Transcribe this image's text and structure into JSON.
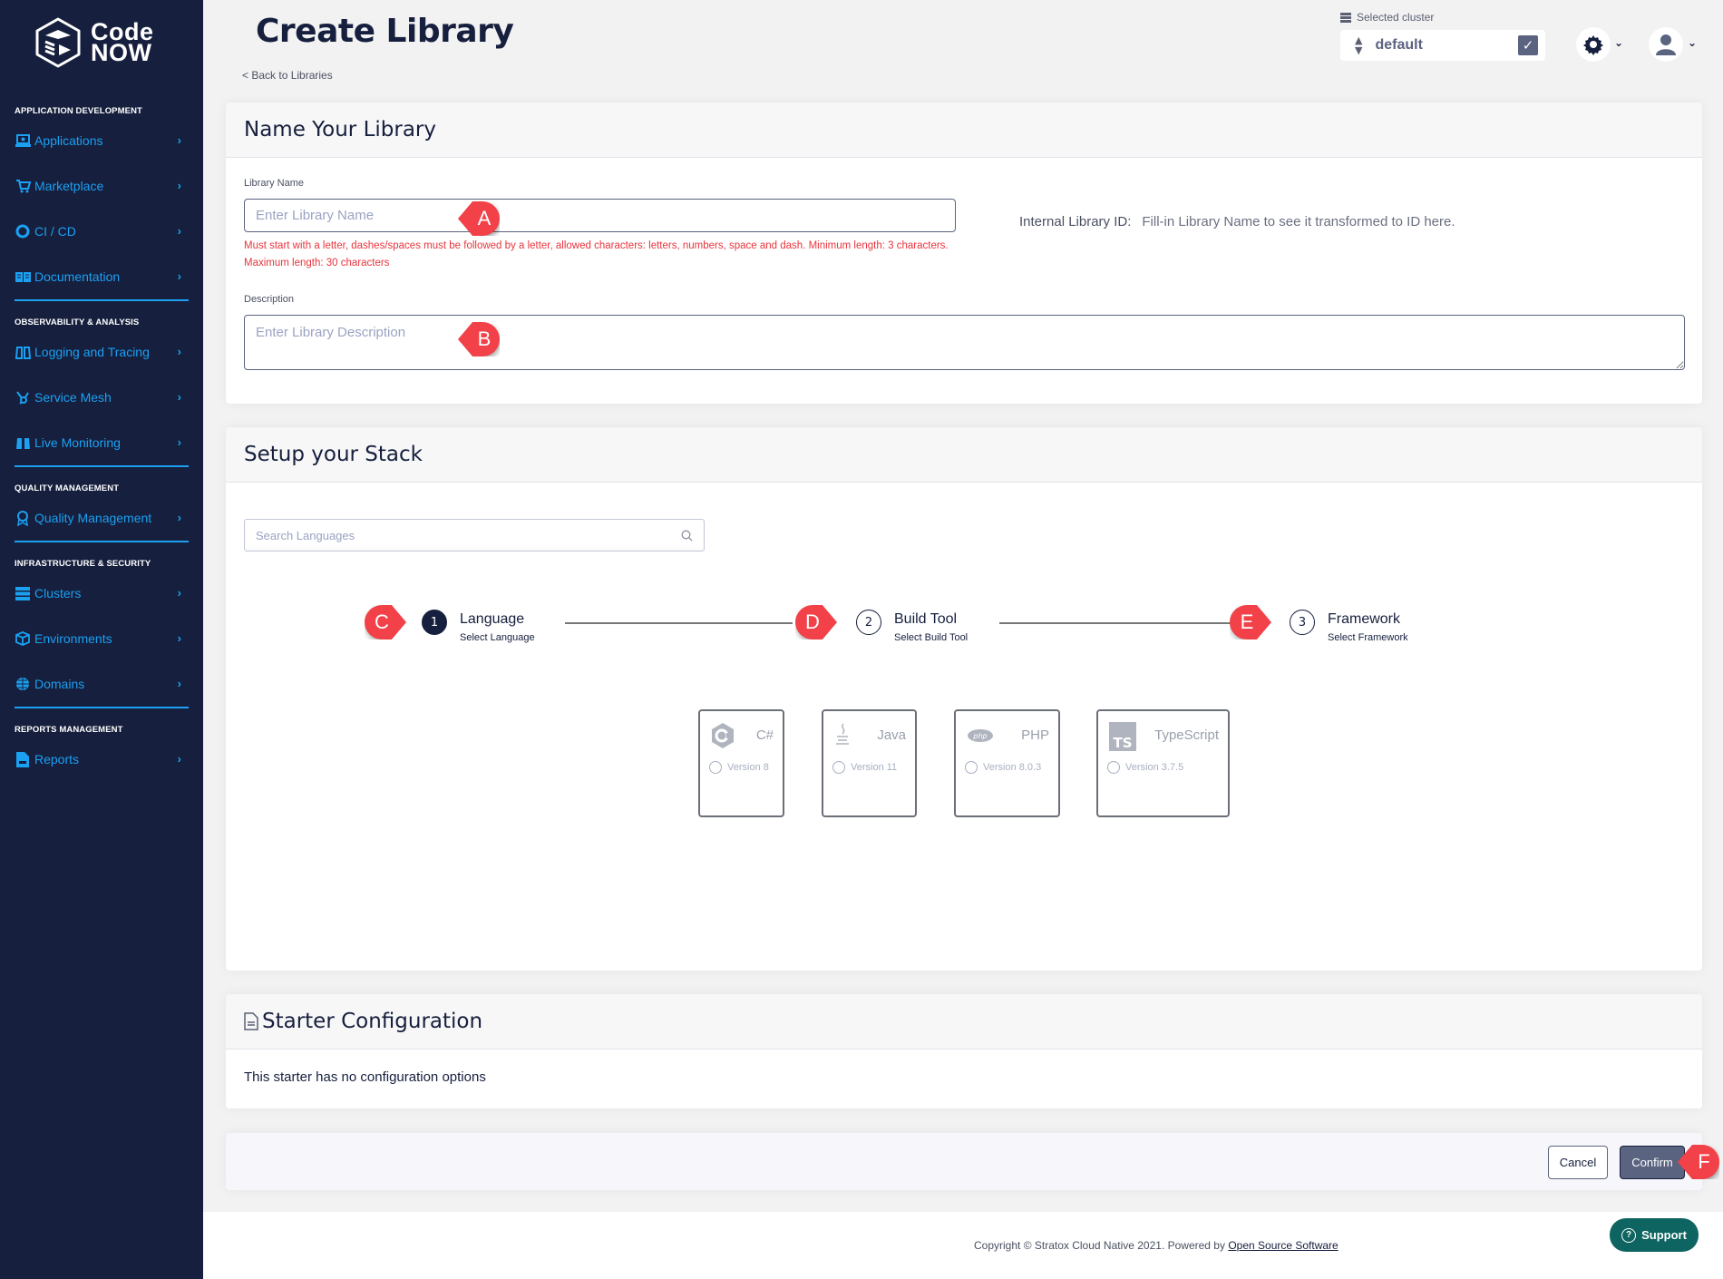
{
  "brand": {
    "line1": "Code",
    "line2": "NOW"
  },
  "sidebar": {
    "sections": [
      {
        "title": "APPLICATION DEVELOPMENT",
        "items": [
          {
            "label": "Applications",
            "icon": "laptop-icon"
          },
          {
            "label": "Marketplace",
            "icon": "cart-icon"
          },
          {
            "label": "CI / CD",
            "icon": "circle-icon"
          },
          {
            "label": "Documentation",
            "icon": "book-icon"
          }
        ]
      },
      {
        "title": "OBSERVABILITY & ANALYSIS",
        "items": [
          {
            "label": "Logging and Tracing",
            "icon": "binoculars-icon"
          },
          {
            "label": "Service Mesh",
            "icon": "hub-icon"
          },
          {
            "label": "Live Monitoring",
            "icon": "binoculars-icon"
          }
        ]
      },
      {
        "title": "QUALITY MANAGEMENT",
        "items": [
          {
            "label": "Quality Management",
            "icon": "award-icon"
          }
        ]
      },
      {
        "title": "INFRASTRUCTURE & SECURITY",
        "items": [
          {
            "label": "Clusters",
            "icon": "server-icon"
          },
          {
            "label": "Environments",
            "icon": "cube-icon"
          },
          {
            "label": "Domains",
            "icon": "globe-icon"
          }
        ]
      },
      {
        "title": "REPORTS MANAGEMENT",
        "items": [
          {
            "label": "Reports",
            "icon": "report-icon"
          }
        ]
      }
    ],
    "chevron": "›"
  },
  "header": {
    "title": "Create Library",
    "back_link": "< Back to Libraries",
    "cluster_label": "Selected cluster",
    "cluster_value": "default"
  },
  "name_card": {
    "title": "Name Your Library",
    "name_label": "Library Name",
    "name_placeholder": "Enter Library Name",
    "name_value": "",
    "name_error": "Must start with a letter, dashes/spaces must be followed by a letter, allowed characters: letters, numbers, space and dash. Minimum length: 3 characters. Maximum length: 30 characters",
    "description_label": "Description",
    "description_placeholder": "Enter Library Description",
    "description_value": "",
    "internal_id_label": "Internal Library ID:",
    "internal_id_value": "Fill-in Library Name to see it transformed to ID here."
  },
  "stack_card": {
    "title": "Setup your Stack",
    "search_placeholder": "Search Languages",
    "steps": [
      {
        "number": "1",
        "title": "Language",
        "subtitle": "Select Language",
        "active": true
      },
      {
        "number": "2",
        "title": "Build Tool",
        "subtitle": "Select Build Tool",
        "active": false
      },
      {
        "number": "3",
        "title": "Framework",
        "subtitle": "Select Framework",
        "active": false
      }
    ],
    "languages": [
      {
        "name": "C#",
        "version": "Version 8",
        "icon": "csharp-icon",
        "selected": false
      },
      {
        "name": "Java",
        "version": "Version 11",
        "icon": "java-icon",
        "selected": false
      },
      {
        "name": "PHP",
        "version": "Version 8.0.3",
        "icon": "php-icon",
        "selected": false
      },
      {
        "name": "TypeScript",
        "version": "Version 3.7.5",
        "icon": "typescript-icon",
        "selected": false
      }
    ]
  },
  "starter_card": {
    "title": "Starter Configuration",
    "body": "This starter has no configuration options"
  },
  "actions": {
    "cancel": "Cancel",
    "confirm": "Confirm"
  },
  "footer": {
    "copyright": "Copyright © Stratox Cloud Native 2021. Powered by ",
    "link": "Open Source Software",
    "support": "Support"
  },
  "markers": [
    "A",
    "B",
    "C",
    "D",
    "E",
    "F"
  ],
  "colors": {
    "sidebar_bg": "#161f3d",
    "accent": "#1ba0f2",
    "error": "#e8343c",
    "primary_btn": "#5a6380",
    "support": "#0d6460",
    "marker": "#f24148"
  }
}
